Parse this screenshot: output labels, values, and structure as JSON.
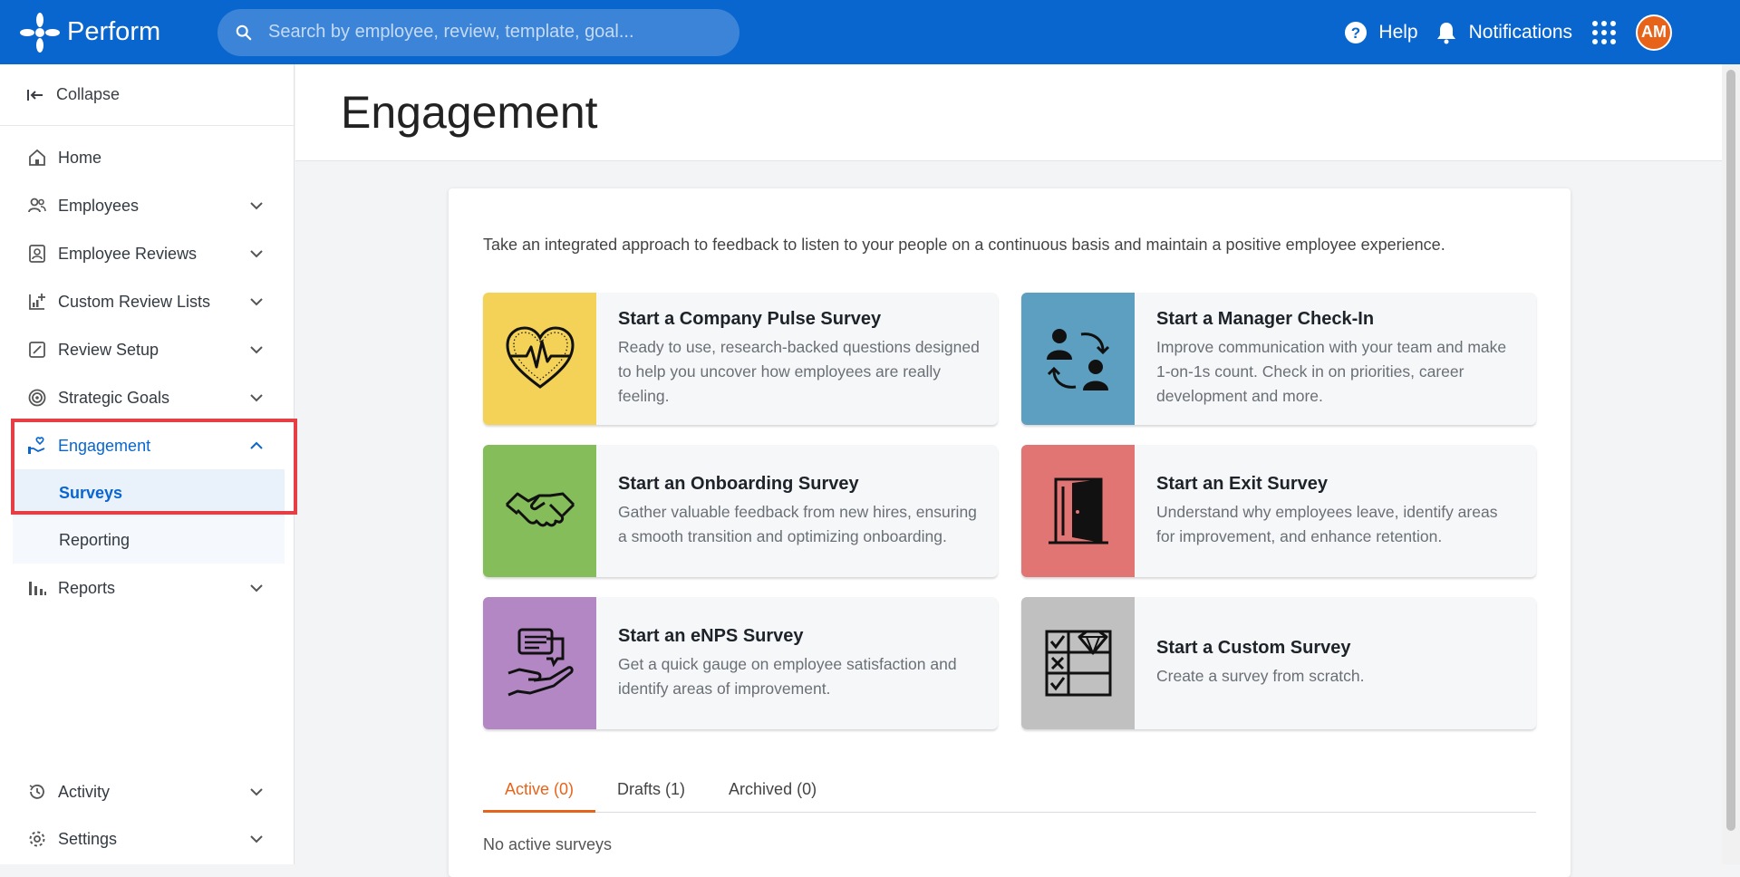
{
  "app": {
    "name": "Perform"
  },
  "search": {
    "placeholder": "Search by employee, review, template, goal..."
  },
  "topbar": {
    "help": "Help",
    "notifications": "Notifications",
    "avatar_initials": "AM",
    "accent": "#0a66cf",
    "avatar_color": "#e8631a"
  },
  "sidebar": {
    "collapse": "Collapse",
    "items": [
      {
        "label": "Home"
      },
      {
        "label": "Employees"
      },
      {
        "label": "Employee Reviews"
      },
      {
        "label": "Custom Review Lists"
      },
      {
        "label": "Review Setup"
      },
      {
        "label": "Strategic Goals"
      },
      {
        "label": "Engagement"
      },
      {
        "label": "Reports"
      },
      {
        "label": "Activity"
      },
      {
        "label": "Settings"
      }
    ],
    "engagement_sub": [
      {
        "label": "Surveys"
      },
      {
        "label": "Reporting"
      }
    ]
  },
  "page": {
    "title": "Engagement"
  },
  "engagement": {
    "intro": "Take an integrated approach to feedback to listen to your people on a continuous basis and maintain a positive employee experience.",
    "tiles": [
      {
        "title": "Start a Company Pulse Survey",
        "desc": "Ready to use, research-backed questions designed to help you uncover how employees are really feeling.",
        "color": "#f3d257",
        "icon": "heart-pulse-icon"
      },
      {
        "title": "Start a Manager Check-In",
        "desc": "Improve communication with your team and make 1-on-1s count. Check in on priorities, career development and more.",
        "color": "#5d9fc0",
        "icon": "people-exchange-icon"
      },
      {
        "title": "Start an Onboarding Survey",
        "desc": "Gather valuable feedback from new hires, ensuring a smooth transition and optimizing onboarding.",
        "color": "#86bd5b",
        "icon": "handshake-icon"
      },
      {
        "title": "Start an Exit Survey",
        "desc": "Understand why employees leave, identify areas for improvement, and enhance retention.",
        "color": "#e07574",
        "icon": "open-door-icon"
      },
      {
        "title": "Start an eNPS Survey",
        "desc": "Get a quick gauge on employee satisfaction and identify areas of improvement.",
        "color": "#b287c3",
        "icon": "hand-chat-icon"
      },
      {
        "title": "Start a Custom Survey",
        "desc": "Create a survey from scratch.",
        "color": "#c0c0c0",
        "icon": "checklist-diamond-icon"
      }
    ],
    "tabs": [
      {
        "label": "Active (0)"
      },
      {
        "label": "Drafts (1)"
      },
      {
        "label": "Archived (0)"
      }
    ],
    "empty": "No active surveys"
  }
}
